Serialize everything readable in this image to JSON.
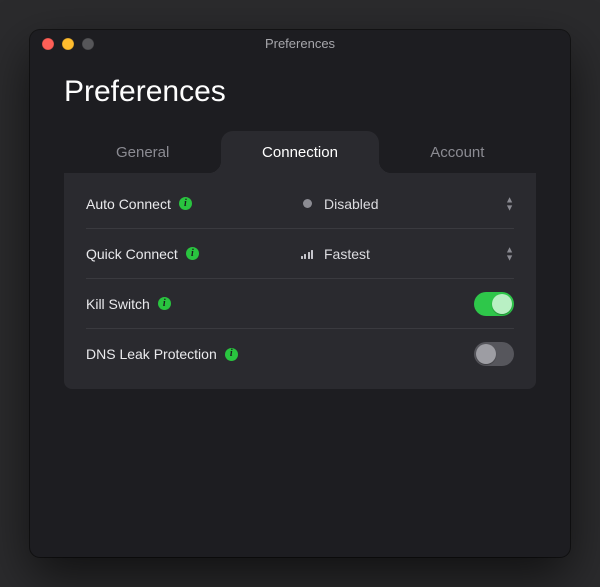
{
  "window": {
    "title": "Preferences"
  },
  "header": {
    "page_title": "Preferences"
  },
  "tabs": {
    "items": [
      {
        "label": "General"
      },
      {
        "label": "Connection"
      },
      {
        "label": "Account"
      }
    ],
    "active_index": 1
  },
  "connection": {
    "rows": [
      {
        "label": "Auto Connect",
        "value": "Disabled",
        "icon": "disabled-dot-icon"
      },
      {
        "label": "Quick Connect",
        "value": "Fastest",
        "icon": "signal-bars-icon"
      },
      {
        "label": "Kill Switch",
        "on": true
      },
      {
        "label": "DNS Leak Protection",
        "on": false
      }
    ]
  },
  "colors": {
    "accent_green": "#2ec74a",
    "panel_bg": "#2a2a2f",
    "window_bg": "#1d1d21"
  }
}
